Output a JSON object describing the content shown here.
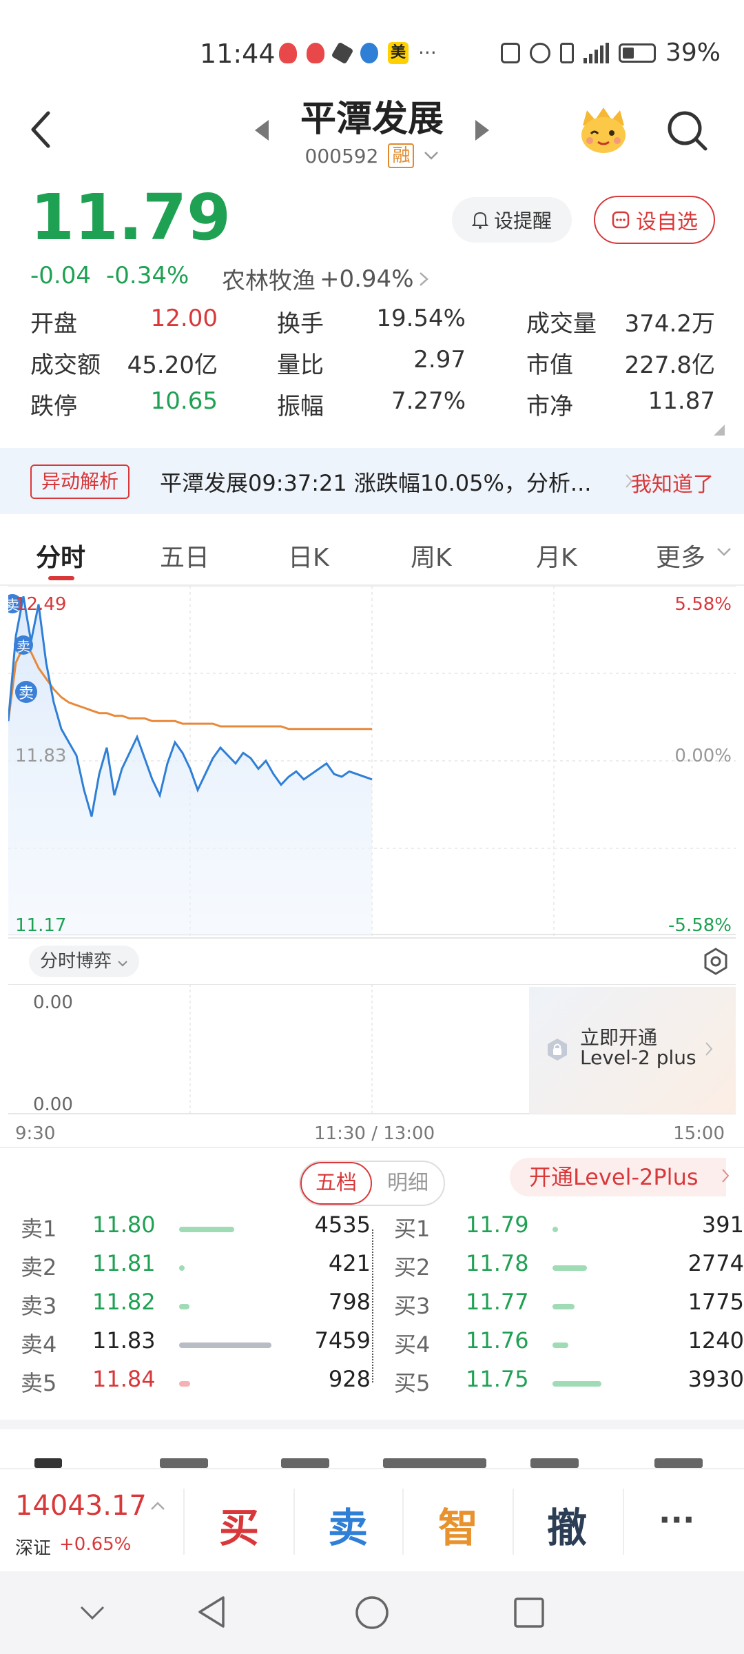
{
  "status_bar": {
    "time": "11:44",
    "app_badge": "美",
    "more": "···",
    "battery": "39%"
  },
  "header": {
    "title": "平潭发展",
    "code": "000592",
    "badge": "融"
  },
  "quote": {
    "price": "11.79",
    "change": "-0.04",
    "change_pct": "-0.34%",
    "sector_name": "农林牧渔",
    "sector_change": "+0.94%",
    "alert_label": "设提醒",
    "favorite_label": "设自选",
    "stats": [
      {
        "label": "开盘",
        "value": "12.00",
        "color": "#d9383a"
      },
      {
        "label": "换手",
        "value": "19.54%",
        "color": "#333333"
      },
      {
        "label": "成交量",
        "value": "374.2万",
        "color": "#333333"
      },
      {
        "label": "成交额",
        "value": "45.20亿",
        "color": "#333333"
      },
      {
        "label": "量比",
        "value": "2.97",
        "color": "#333333"
      },
      {
        "label": "市值",
        "value": "227.8亿",
        "color": "#333333"
      },
      {
        "label": "跌停",
        "value": "10.65",
        "color": "#1fa153"
      },
      {
        "label": "振幅",
        "value": "7.27%",
        "color": "#333333"
      },
      {
        "label": "市净",
        "value": "11.87",
        "color": "#333333"
      }
    ]
  },
  "banner": {
    "tag": "异动解析",
    "text": "平潭发展09:37:21 涨跌幅10.05%，分析...",
    "dismiss": "我知道了"
  },
  "tabs": [
    "分时",
    "五日",
    "日K",
    "周K",
    "月K",
    "更多"
  ],
  "chart": {
    "price_high": "12.49",
    "price_mid": "11.83",
    "price_low": "11.17",
    "pct_high": "5.58%",
    "pct_mid": "0.00%",
    "pct_low": "-5.58%",
    "sell_marker": "卖",
    "sub_indicator": "分时博弈",
    "sub_top": "0.00",
    "sub_bottom": "0.00",
    "level2_title": "立即开通",
    "level2_sub": "Level-2 plus",
    "time_start": "9:30",
    "time_mid": "11:30 / 13:00",
    "time_end": "15:00"
  },
  "chart_data": {
    "type": "line",
    "ylim": [
      11.17,
      12.49
    ],
    "x_range": [
      "9:30",
      "15:00"
    ],
    "series": [
      {
        "values": [
          11.98,
          12.3,
          12.45,
          12.28,
          12.42,
          12.2,
          12.05,
          11.95,
          11.9,
          11.85,
          11.72,
          11.62,
          11.78,
          11.88,
          11.7,
          11.8,
          11.86,
          11.92,
          11.84,
          11.76,
          11.7,
          11.82,
          11.9,
          11.86,
          11.8,
          11.72,
          11.78,
          11.84,
          11.88,
          11.85,
          11.82,
          11.86,
          11.84,
          11.8,
          11.83,
          11.78,
          11.74,
          11.77,
          11.79,
          11.76,
          11.78,
          11.8,
          11.82,
          11.78,
          11.77,
          11.79,
          11.78,
          11.77,
          11.76
        ],
        "color": "#2f7fd6"
      },
      {
        "values": [
          11.98,
          12.2,
          12.26,
          12.24,
          12.18,
          12.14,
          12.1,
          12.07,
          12.05,
          12.04,
          12.03,
          12.02,
          12.01,
          12.01,
          12.0,
          12.0,
          11.99,
          11.99,
          11.99,
          11.98,
          11.98,
          11.98,
          11.98,
          11.97,
          11.97,
          11.97,
          11.97,
          11.97,
          11.96,
          11.96,
          11.96,
          11.96,
          11.96,
          11.96,
          11.96,
          11.96,
          11.96,
          11.95,
          11.95,
          11.95,
          11.95,
          11.95,
          11.95,
          11.95,
          11.95,
          11.95,
          11.95,
          11.95,
          11.95
        ],
        "color": "#e8893a"
      }
    ],
    "grid": true
  },
  "order_book": {
    "toggle_active": "五档",
    "toggle_inactive": "明细",
    "level2_plus": "开通Level-2Plus",
    "asks": [
      {
        "label": "卖1",
        "price": "11.80",
        "volume": "4535",
        "price_color": "#1fa153",
        "bar_color": "#9fdcb6",
        "bar_frac": 0.6
      },
      {
        "label": "卖2",
        "price": "11.81",
        "volume": "421",
        "price_color": "#1fa153",
        "bar_color": "#9fdcb6",
        "bar_frac": 0.06
      },
      {
        "label": "卖3",
        "price": "11.82",
        "volume": "798",
        "price_color": "#1fa153",
        "bar_color": "#9fdcb6",
        "bar_frac": 0.11
      },
      {
        "label": "卖4",
        "price": "11.83",
        "volume": "7459",
        "price_color": "#222222",
        "bar_color": "#b8bcc4",
        "bar_frac": 1.0
      },
      {
        "label": "卖5",
        "price": "11.84",
        "volume": "928",
        "price_color": "#d9383a",
        "bar_color": "#f4b2b4",
        "bar_frac": 0.12
      }
    ],
    "bids": [
      {
        "label": "买1",
        "price": "11.79",
        "volume": "391",
        "price_color": "#1fa153",
        "bar_color": "#9fdcb6",
        "bar_frac": 0.06
      },
      {
        "label": "买2",
        "price": "11.78",
        "volume": "2774",
        "price_color": "#1fa153",
        "bar_color": "#9fdcb6",
        "bar_frac": 0.37
      },
      {
        "label": "买3",
        "price": "11.77",
        "volume": "1775",
        "price_color": "#1fa153",
        "bar_color": "#9fdcb6",
        "bar_frac": 0.24
      },
      {
        "label": "买4",
        "price": "11.76",
        "volume": "1240",
        "price_color": "#1fa153",
        "bar_color": "#9fdcb6",
        "bar_frac": 0.17
      },
      {
        "label": "买5",
        "price": "11.75",
        "volume": "3930",
        "price_color": "#1fa153",
        "bar_color": "#9fdcb6",
        "bar_frac": 0.53
      }
    ]
  },
  "trade_bar": {
    "index_value": "14043.17",
    "index_name": "深证",
    "index_change": "+0.65%",
    "buy": "买",
    "sell": "卖",
    "smart": "智",
    "cancel": "撤",
    "more": "···"
  },
  "colors": {
    "up": "#d9383a",
    "down": "#1fa153",
    "price_line": "#2f7fd6",
    "avg_line": "#e8893a"
  }
}
